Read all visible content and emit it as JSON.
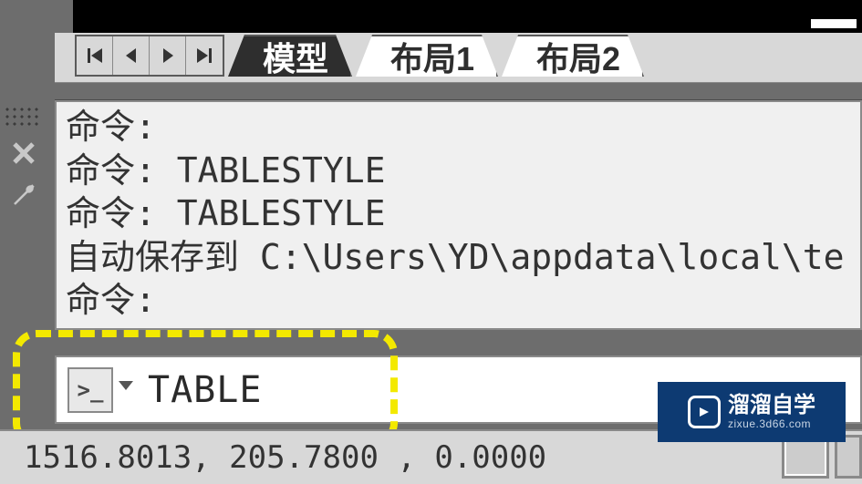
{
  "tabs": {
    "model": "模型",
    "layout1": "布局1",
    "layout2": "布局2"
  },
  "history": {
    "line1": "命令:",
    "line2": "命令: TABLESTYLE",
    "line3": "命令: TABLESTYLE",
    "line4": "自动保存到 C:\\Users\\YD\\appdata\\local\\te",
    "line5": "命令:"
  },
  "command": {
    "prompt_glyph": ">_",
    "input_value": "TABLE"
  },
  "status": {
    "coords": "1516.8013, 205.7800 , 0.0000"
  },
  "watermark": {
    "title": "溜溜自学",
    "url": "zixue.3d66.com"
  }
}
